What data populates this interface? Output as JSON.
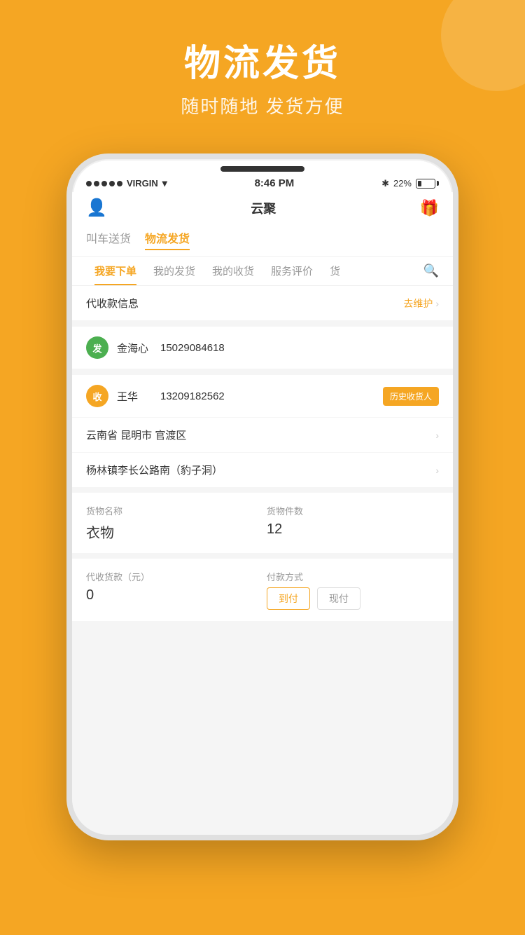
{
  "background": {
    "color": "#F5A623"
  },
  "header": {
    "title": "物流发货",
    "subtitle": "随时随地 发货方便"
  },
  "status_bar": {
    "carrier": "VIRGIN",
    "time": "8:46 PM",
    "bluetooth": "✱",
    "battery_percent": "22%"
  },
  "app_bar": {
    "title": "云聚",
    "gift_icon": "🎁",
    "user_icon": "👤"
  },
  "top_tabs": [
    {
      "label": "叫车送货",
      "active": false
    },
    {
      "label": "物流发货",
      "active": true
    }
  ],
  "sub_tabs": [
    {
      "label": "我要下单",
      "active": true
    },
    {
      "label": "我的发货",
      "active": false
    },
    {
      "label": "我的收货",
      "active": false
    },
    {
      "label": "服务评价",
      "active": false
    },
    {
      "label": "货",
      "active": false
    }
  ],
  "collection_info": {
    "label": "代收款信息",
    "action": "去维护"
  },
  "sender": {
    "badge": "发",
    "name": "金海心",
    "phone": "15029084618"
  },
  "receiver": {
    "badge": "收",
    "name": "王华",
    "phone": "13209182562",
    "history_btn": "历史收货人"
  },
  "address": {
    "region": "云南省 昆明市 官渡区",
    "detail": "杨林镇李长公路南（豹子洞）"
  },
  "goods": {
    "name_label": "货物名称",
    "name_value": "衣物",
    "count_label": "货物件数",
    "count_value": "12"
  },
  "payment": {
    "cod_label": "代收货款（元）",
    "cod_value": "0",
    "method_label": "付款方式",
    "options": [
      {
        "label": "到付",
        "active": true
      },
      {
        "label": "现付",
        "active": false
      }
    ]
  }
}
